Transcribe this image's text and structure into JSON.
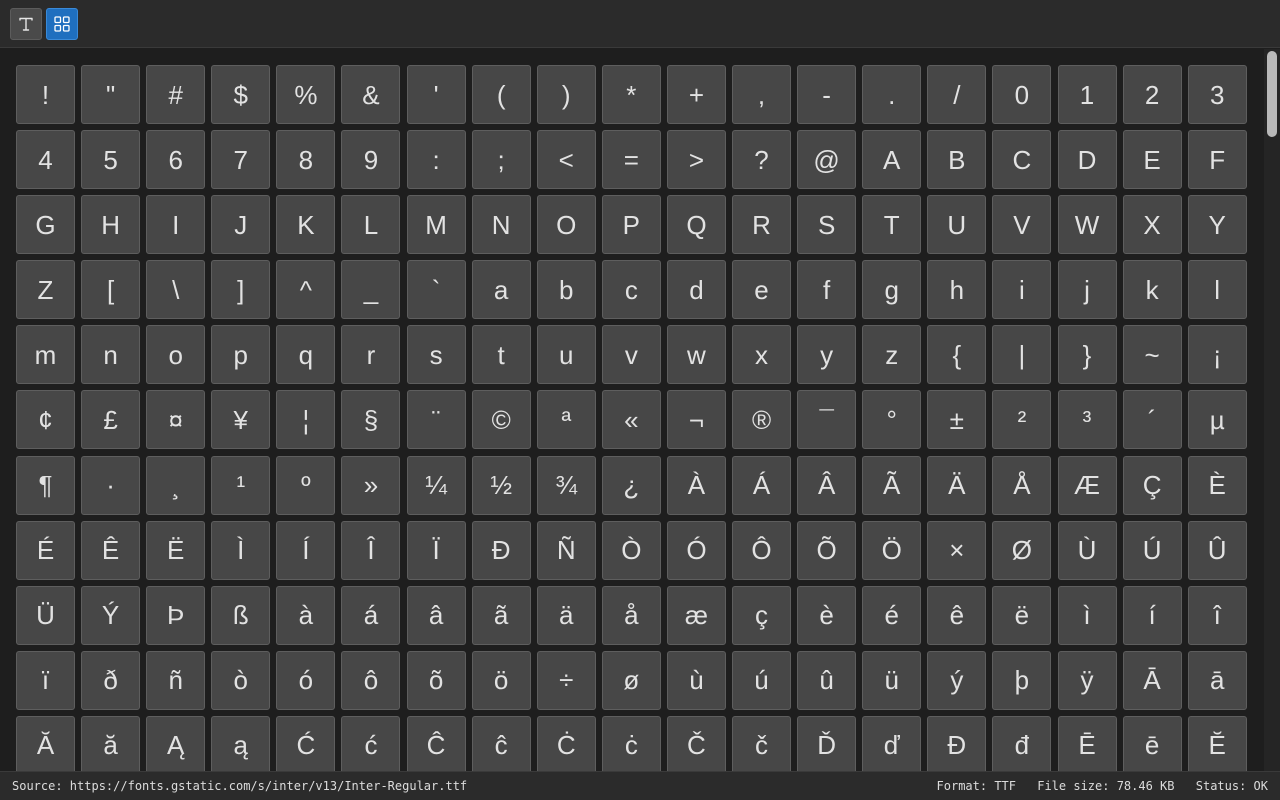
{
  "toolbar": {
    "text_view_icon": "text-cursor-icon",
    "grid_view_icon": "grid-icon",
    "active_view": "grid"
  },
  "glyphs": [
    "!",
    "\"",
    "#",
    "$",
    "%",
    "&",
    "'",
    "(",
    ")",
    "*",
    "+",
    ",",
    "-",
    ".",
    "/",
    "0",
    "1",
    "2",
    "3",
    "4",
    "5",
    "6",
    "7",
    "8",
    "9",
    ":",
    ";",
    "<",
    "=",
    ">",
    "?",
    "@",
    "A",
    "B",
    "C",
    "D",
    "E",
    "F",
    "G",
    "H",
    "I",
    "J",
    "K",
    "L",
    "M",
    "N",
    "O",
    "P",
    "Q",
    "R",
    "S",
    "T",
    "U",
    "V",
    "W",
    "X",
    "Y",
    "Z",
    "[",
    "\\",
    "]",
    "^",
    "_",
    "`",
    "a",
    "b",
    "c",
    "d",
    "e",
    "f",
    "g",
    "h",
    "i",
    "j",
    "k",
    "l",
    "m",
    "n",
    "o",
    "p",
    "q",
    "r",
    "s",
    "t",
    "u",
    "v",
    "w",
    "x",
    "y",
    "z",
    "{",
    "|",
    "}",
    "~",
    "¡",
    "¢",
    "£",
    "¤",
    "¥",
    "¦",
    "§",
    "¨",
    "©",
    "ª",
    "«",
    "¬",
    "®",
    "¯",
    "°",
    "±",
    "²",
    "³",
    "´",
    "µ",
    "¶",
    "·",
    "¸",
    "¹",
    "º",
    "»",
    "¼",
    "½",
    "¾",
    "¿",
    "À",
    "Á",
    "Â",
    "Ã",
    "Ä",
    "Å",
    "Æ",
    "Ç",
    "È",
    "É",
    "Ê",
    "Ë",
    "Ì",
    "Í",
    "Î",
    "Ï",
    "Ð",
    "Ñ",
    "Ò",
    "Ó",
    "Ô",
    "Õ",
    "Ö",
    "×",
    "Ø",
    "Ù",
    "Ú",
    "Û",
    "Ü",
    "Ý",
    "Þ",
    "ß",
    "à",
    "á",
    "â",
    "ã",
    "ä",
    "å",
    "æ",
    "ç",
    "è",
    "é",
    "ê",
    "ë",
    "ì",
    "í",
    "î",
    "ï",
    "ð",
    "ñ",
    "ò",
    "ó",
    "ô",
    "õ",
    "ö",
    "÷",
    "ø",
    "ù",
    "ú",
    "û",
    "ü",
    "ý",
    "þ",
    "ÿ",
    "Ā",
    "ā",
    "Ă",
    "ă",
    "Ą",
    "ą",
    "Ć",
    "ć",
    "Ĉ",
    "ĉ",
    "Ċ",
    "ċ",
    "Č",
    "č",
    "Ď",
    "ď",
    "Đ",
    "đ",
    "Ē",
    "ē",
    "Ĕ"
  ],
  "status": {
    "source": "Source: https://fonts.gstatic.com/s/inter/v13/Inter-Regular.ttf",
    "format": "Format: TTF",
    "file_size": "File size: 78.46 KB",
    "status": "Status: OK"
  },
  "colors": {
    "accent": "#1f6fbf",
    "background": "#1e1e1e",
    "tile": "#474747",
    "glyph_text": "#e2e2e2"
  }
}
